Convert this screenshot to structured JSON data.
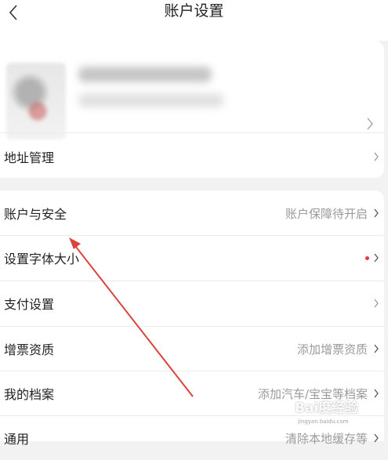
{
  "header": {
    "title": "账户设置"
  },
  "profile": {
    "name": "",
    "subtitle": ""
  },
  "address": {
    "label": "地址管理"
  },
  "items": [
    {
      "label": "账户与安全",
      "value": "账户保障待开启"
    },
    {
      "label": "设置字体大小",
      "value": "",
      "has_dot": true
    },
    {
      "label": "支付设置",
      "value": ""
    },
    {
      "label": "增票资质",
      "value": "添加增票资质"
    },
    {
      "label": "我的档案",
      "value": "添加汽车/宝宝等档案"
    },
    {
      "label": "通用",
      "value": "清除本地缓存等"
    }
  ],
  "watermark": {
    "logo": "Bai度经验",
    "url": "jingyan.baidu.com"
  },
  "colors": {
    "badge_dot": "#e8364a",
    "arrow": "#d9443f"
  }
}
